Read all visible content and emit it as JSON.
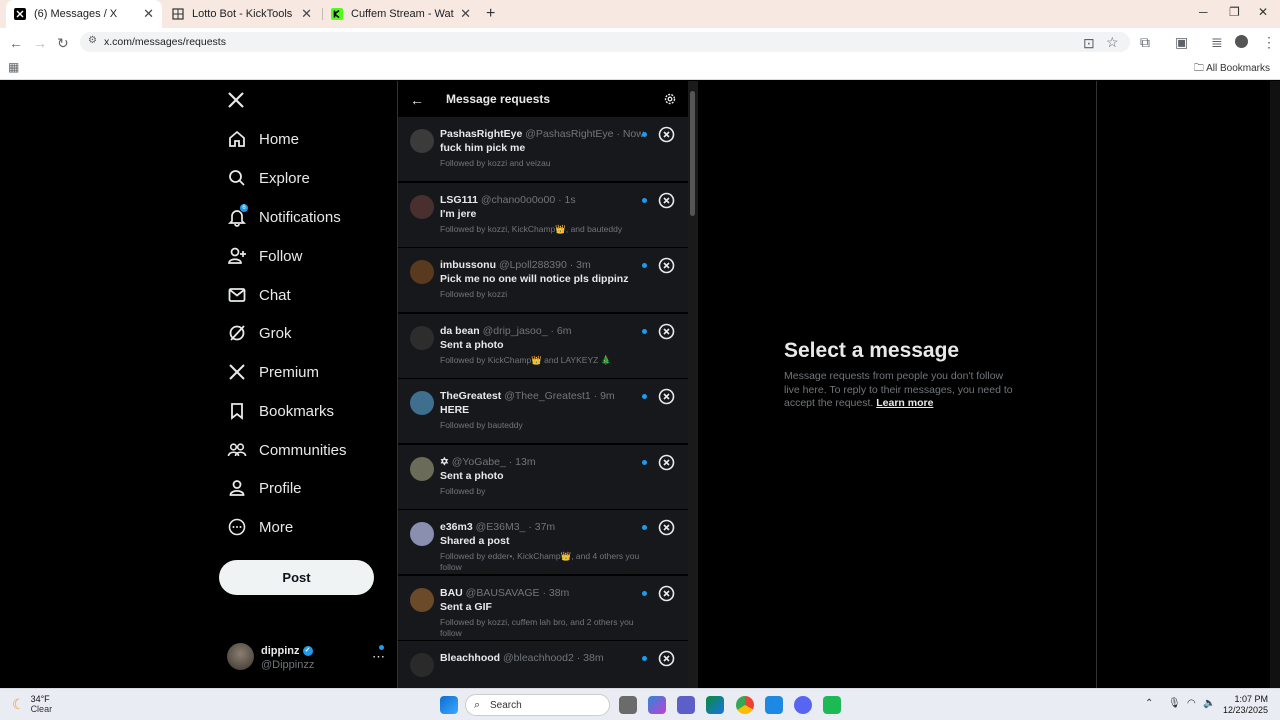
{
  "browser": {
    "tabs": [
      {
        "title": "(6) Messages / X",
        "active": true
      },
      {
        "title": "Lotto Bot - KickTools",
        "active": false
      },
      {
        "title": "Cuffem Stream - Watch Live on",
        "active": false
      }
    ],
    "url": "x.com/messages/requests",
    "all_bookmarks": "All Bookmarks"
  },
  "nav": {
    "items": [
      {
        "label": "Home",
        "icon": "home-icon"
      },
      {
        "label": "Explore",
        "icon": "search-icon"
      },
      {
        "label": "Notifications",
        "icon": "bell-icon",
        "badge": "6"
      },
      {
        "label": "Follow",
        "icon": "follow-icon"
      },
      {
        "label": "Chat",
        "icon": "mail-icon"
      },
      {
        "label": "Grok",
        "icon": "grok-icon"
      },
      {
        "label": "Premium",
        "icon": "x-logo-icon"
      },
      {
        "label": "Bookmarks",
        "icon": "bookmark-icon"
      },
      {
        "label": "Communities",
        "icon": "communities-icon"
      },
      {
        "label": "Profile",
        "icon": "profile-icon"
      },
      {
        "label": "More",
        "icon": "more-icon"
      }
    ],
    "post_label": "Post",
    "user": {
      "name": "dippinz",
      "handle": "@Dippinzz"
    }
  },
  "requests": {
    "title": "Message requests",
    "items": [
      {
        "name": "PashasRightEye",
        "handle": "@PashasRightEye",
        "time": "· Now",
        "message": "fuck him pick me",
        "followed": "Followed by kozzi and veizau",
        "avatar_color": "#3b3b3b"
      },
      {
        "name": "LSG111",
        "handle": "@chano0o0o00",
        "time": "· 1s",
        "message": "I'm jere",
        "followed": "Followed by kozzi, KickChamp👑, and bauteddy",
        "avatar_color": "#4a2f2f"
      },
      {
        "name": "imbussonu",
        "handle": "@Lpoll288390",
        "time": "· 3m",
        "message": "Pick me no one will notice pls dippinz",
        "followed": "Followed by kozzi",
        "avatar_color": "#5a3a1e"
      },
      {
        "name": "da bean",
        "handle": "@drip_jasoo_",
        "time": "· 6m",
        "message": "Sent a photo",
        "followed": "Followed by KickChamp👑 and LAYKEYZ 🎄",
        "avatar_color": "#2d2d2d"
      },
      {
        "name": "TheGreatest",
        "handle": "@Thee_Greatest1",
        "time": "· 9m",
        "message": "HERE",
        "followed": "Followed by bauteddy",
        "avatar_color": "#3f6f8f"
      },
      {
        "name": "✡",
        "handle": "@YoGabe_",
        "time": "· 13m",
        "message": "Sent a photo",
        "followed": "Followed by",
        "avatar_color": "#6b6b5a"
      },
      {
        "name": "e36m3",
        "handle": "@E36M3_",
        "time": "· 37m",
        "message": "Shared a post",
        "followed": "Followed by edder•, KickChamp👑, and 4 others you follow",
        "avatar_color": "#8a8fb0"
      },
      {
        "name": "BAU",
        "handle": "@BAUSAVAGE",
        "time": "· 38m",
        "message": "Sent a GIF",
        "followed": "Followed by kozzi, cuffem lah bro, and 2 others you follow",
        "avatar_color": "#6b4a2a"
      },
      {
        "name": "Bleachhood",
        "handle": "@bleachhood2",
        "time": "· 38m",
        "message": "",
        "followed": "",
        "avatar_color": "#2a2a2a"
      }
    ]
  },
  "empty_state": {
    "title": "Select a message",
    "body": "Message requests from people you don't follow live here. To reply to their messages, you need to accept the request.",
    "link": "Learn more"
  },
  "taskbar": {
    "temp": "34°F",
    "condition": "Clear",
    "search": "Search",
    "time": "1:07 PM",
    "date": "12/23/2025"
  }
}
